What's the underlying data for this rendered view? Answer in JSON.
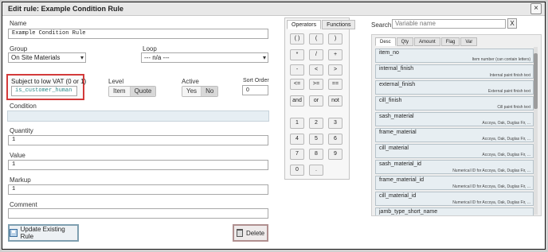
{
  "window": {
    "title": "Edit rule: Example Condition Rule",
    "close": "×"
  },
  "form": {
    "name_label": "Name",
    "name_value": "Example Condition Rule",
    "group_label": "Group",
    "group_value": "On Site Materials",
    "loop_label": "Loop",
    "loop_value": "--- n/a ---",
    "vat_label": "Subject to low VAT (0 or 1)",
    "vat_value": "is_customer_human",
    "level_label": "Level",
    "level_options": [
      "Item",
      "Quote"
    ],
    "active_label": "Active",
    "active_options": [
      "Yes",
      "No"
    ],
    "sort_label": "Sort Order",
    "sort_value": "0",
    "condition_label": "Condition",
    "condition_value": "",
    "quantity_label": "Quantity",
    "quantity_value": "1",
    "value_label": "Value",
    "value_value": "1",
    "markup_label": "Markup",
    "markup_value": "1",
    "comment_label": "Comment",
    "comment_value": "",
    "update_button": "Update Existing Rule",
    "delete_button": "Delete"
  },
  "calculator": {
    "tabs": [
      "Operators",
      "Functions"
    ],
    "active_tab": "Operators",
    "keys": [
      [
        "( )",
        "(",
        ")"
      ],
      [
        "*",
        "/",
        "+"
      ],
      [
        "-",
        "<",
        ">"
      ],
      [
        "<=",
        ">=",
        "=="
      ],
      [
        "and",
        "or",
        "not"
      ],
      [
        "1",
        "2",
        "3"
      ],
      [
        "4",
        "5",
        "6"
      ],
      [
        "7",
        "8",
        "9"
      ],
      [
        "0",
        "."
      ]
    ]
  },
  "variables": {
    "search_label": "Search:",
    "search_placeholder": "Variable name",
    "clear_button": "X",
    "tabs": [
      "Desc",
      "Qty",
      "Amount",
      "Flag",
      "Var"
    ],
    "active_tab": "Desc",
    "items": [
      {
        "name": "item_no",
        "desc": "Item number (can contain letters)"
      },
      {
        "name": "internal_finish",
        "desc": "Internal paint finish text"
      },
      {
        "name": "external_finish",
        "desc": "External paint finish text"
      },
      {
        "name": "cill_finish",
        "desc": "Cill paint finish text"
      },
      {
        "name": "sash_material",
        "desc": "Accoya, Oak, Duglas Fir, ..."
      },
      {
        "name": "frame_material",
        "desc": "Accoya, Oak, Duglas Fir, ..."
      },
      {
        "name": "cill_material",
        "desc": "Accoya, Oak, Duglas Fir, ..."
      },
      {
        "name": "sash_material_id",
        "desc": "Numerical ID for Accoya, Oak, Duglas Fir, ..."
      },
      {
        "name": "frame_material_id",
        "desc": "Numerical ID for Accoya, Oak, Duglas Fir, ..."
      },
      {
        "name": "cill_material_id",
        "desc": "Numerical ID for Accoya, Oak, Duglas Fir, ..."
      },
      {
        "name": "jamb_type_short_name",
        "desc": ""
      }
    ]
  }
}
